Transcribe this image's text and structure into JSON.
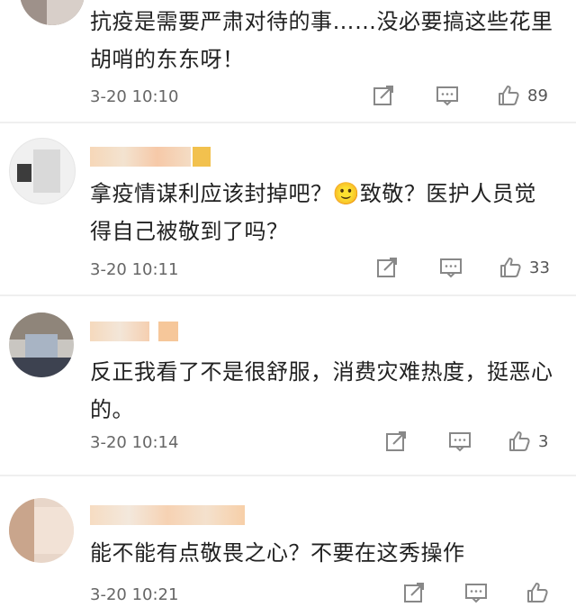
{
  "comments": [
    {
      "text": "抗疫是需要严肃对待的事……没必要搞这些花里胡哨的东东呀！",
      "time": "3-20 10:10",
      "likes": "89"
    },
    {
      "text": "拿疫情谋利应该封掉吧？🙂致敬？医护人员觉得自己被敬到了吗？",
      "time": "3-20 10:11",
      "likes": "33"
    },
    {
      "text": "反正我看了不是很舒服，消费灾难热度，挺恶心的。",
      "time": "3-20 10:14",
      "likes": "3"
    },
    {
      "text": "能不能有点敬畏之心？不要在这秀操作",
      "time": "3-20 10:21",
      "likes": ""
    }
  ],
  "icons": {
    "share": "share-icon",
    "comment": "comment-icon",
    "like": "thumbs-up-icon"
  },
  "colors": {
    "text": "#222222",
    "meta": "#666666",
    "icon": "#888888",
    "badge": "#f2c14e"
  }
}
